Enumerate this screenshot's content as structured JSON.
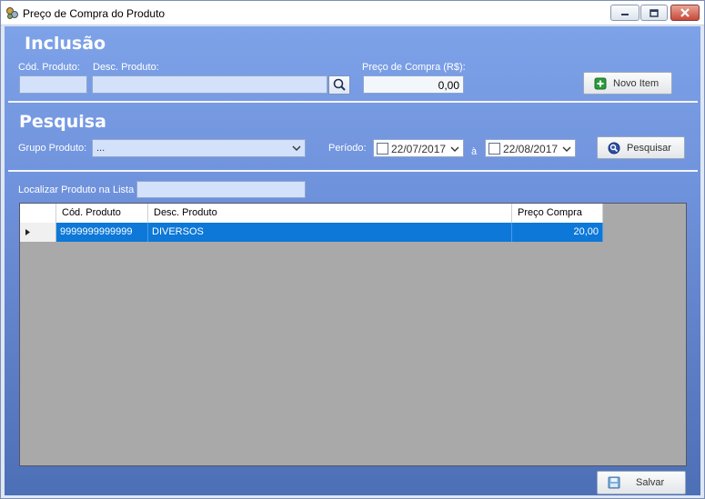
{
  "window": {
    "title": "Preço de Compra do Produto"
  },
  "inclusao": {
    "title": "Inclusão",
    "cod_label": "Cód. Produto:",
    "cod_value": "",
    "desc_label": "Desc. Produto:",
    "desc_value": "",
    "preco_label": "Preço de Compra (R$):",
    "preco_value": "0,00",
    "novo_item_label": "Novo Item"
  },
  "pesquisa": {
    "title": "Pesquisa",
    "grupo_label": "Grupo Produto:",
    "grupo_value": "...",
    "periodo_label": "Período:",
    "data_inicio": "22/07/2017",
    "separator": "à",
    "data_fim": "22/08/2017",
    "pesquisar_label": "Pesquisar"
  },
  "localizar": {
    "label": "Localizar Produto na Lista",
    "value": ""
  },
  "grid": {
    "columns": [
      "Cód. Produto",
      "Desc. Produto",
      "Preço Compra"
    ],
    "rows": [
      {
        "cod": "9999999999999",
        "desc": "DIVERSOS",
        "preco": "20,00"
      }
    ]
  },
  "footer": {
    "salvar_label": "Salvar"
  },
  "colors": {
    "selection": "#0d78d8",
    "panel_top": "#7ea2e8",
    "panel_bottom": "#4d6fb6"
  }
}
